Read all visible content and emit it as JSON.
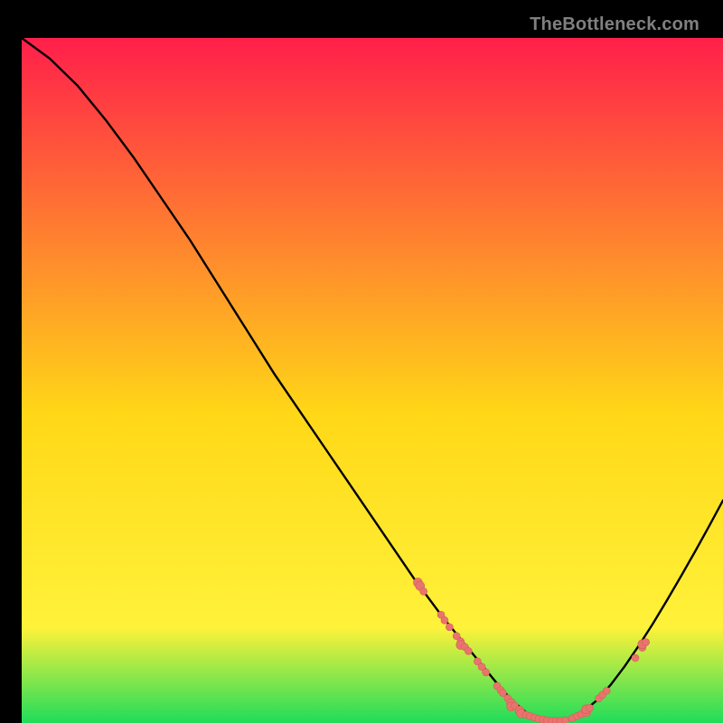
{
  "watermark": "TheBottleneck.com",
  "colors": {
    "bg": "#000000",
    "grad_top": "#ff1f4a",
    "grad_mid": "#ffd817",
    "grad_bottom_y": "#fff23a",
    "grad_green": "#1fdc5a",
    "curve": "#000000",
    "marker_fill": "#e9746e",
    "marker_stroke": "#d45f59"
  },
  "chart_data": {
    "type": "line",
    "title": "",
    "xlabel": "",
    "ylabel": "",
    "xlim": [
      0,
      100
    ],
    "ylim": [
      0,
      100
    ],
    "x": [
      0,
      4,
      8,
      12,
      16,
      20,
      24,
      28,
      32,
      36,
      40,
      44,
      48,
      52,
      56,
      60,
      62,
      64,
      66,
      68,
      70,
      72,
      74,
      76,
      78,
      80,
      82,
      84,
      86,
      88,
      90,
      92,
      94,
      96,
      98,
      100
    ],
    "y": [
      100,
      97,
      93,
      88,
      82.5,
      76.5,
      70.5,
      64,
      57.5,
      51,
      45,
      39,
      33,
      27,
      21,
      15.5,
      13,
      10.5,
      8,
      5.5,
      3.2,
      1.5,
      0.6,
      0.3,
      0.6,
      1.6,
      3.3,
      5.6,
      8.3,
      11.3,
      14.5,
      17.9,
      21.4,
      25,
      28.7,
      32.5
    ],
    "markers": [
      {
        "x": 56.5,
        "y": 20.5,
        "r": 5
      },
      {
        "x": 56.8,
        "y": 20.0,
        "r": 5
      },
      {
        "x": 57.3,
        "y": 19.2,
        "r": 4
      },
      {
        "x": 59.8,
        "y": 15.8,
        "r": 4
      },
      {
        "x": 60.3,
        "y": 15.0,
        "r": 4
      },
      {
        "x": 61.0,
        "y": 14.0,
        "r": 4
      },
      {
        "x": 62.0,
        "y": 12.7,
        "r": 4
      },
      {
        "x": 62.6,
        "y": 11.9,
        "r": 4
      },
      {
        "x": 62.6,
        "y": 11.4,
        "r": 5
      },
      {
        "x": 63.2,
        "y": 11.1,
        "r": 4
      },
      {
        "x": 63.7,
        "y": 10.5,
        "r": 4
      },
      {
        "x": 65.0,
        "y": 9.0,
        "r": 4
      },
      {
        "x": 65.6,
        "y": 8.2,
        "r": 4
      },
      {
        "x": 66.2,
        "y": 7.4,
        "r": 4
      },
      {
        "x": 67.8,
        "y": 5.4,
        "r": 4
      },
      {
        "x": 68.3,
        "y": 4.8,
        "r": 4
      },
      {
        "x": 68.6,
        "y": 4.4,
        "r": 4
      },
      {
        "x": 69.3,
        "y": 3.6,
        "r": 4
      },
      {
        "x": 69.8,
        "y": 2.9,
        "r": 5
      },
      {
        "x": 69.8,
        "y": 2.4,
        "r": 5
      },
      {
        "x": 70.3,
        "y": 2.5,
        "r": 4
      },
      {
        "x": 71.0,
        "y": 1.8,
        "r": 5
      },
      {
        "x": 71.2,
        "y": 1.4,
        "r": 5
      },
      {
        "x": 71.9,
        "y": 1.2,
        "r": 4
      },
      {
        "x": 72.5,
        "y": 1.0,
        "r": 4
      },
      {
        "x": 73.1,
        "y": 0.8,
        "r": 4
      },
      {
        "x": 73.7,
        "y": 0.6,
        "r": 4
      },
      {
        "x": 74.3,
        "y": 0.5,
        "r": 4
      },
      {
        "x": 74.9,
        "y": 0.4,
        "r": 4
      },
      {
        "x": 75.6,
        "y": 0.3,
        "r": 4
      },
      {
        "x": 76.2,
        "y": 0.3,
        "r": 4
      },
      {
        "x": 76.8,
        "y": 0.3,
        "r": 4
      },
      {
        "x": 77.5,
        "y": 0.4,
        "r": 4
      },
      {
        "x": 78.5,
        "y": 0.7,
        "r": 4
      },
      {
        "x": 79.2,
        "y": 1.0,
        "r": 4
      },
      {
        "x": 79.8,
        "y": 1.3,
        "r": 4
      },
      {
        "x": 80.5,
        "y": 1.6,
        "r": 5
      },
      {
        "x": 80.5,
        "y": 2.0,
        "r": 5
      },
      {
        "x": 81.0,
        "y": 2.2,
        "r": 4
      },
      {
        "x": 82.3,
        "y": 3.6,
        "r": 4
      },
      {
        "x": 82.8,
        "y": 4.1,
        "r": 4
      },
      {
        "x": 83.4,
        "y": 4.7,
        "r": 4
      },
      {
        "x": 87.5,
        "y": 9.5,
        "r": 4
      },
      {
        "x": 88.5,
        "y": 11.0,
        "r": 4
      },
      {
        "x": 88.5,
        "y": 11.5,
        "r": 5
      },
      {
        "x": 89.0,
        "y": 11.8,
        "r": 4
      }
    ]
  }
}
